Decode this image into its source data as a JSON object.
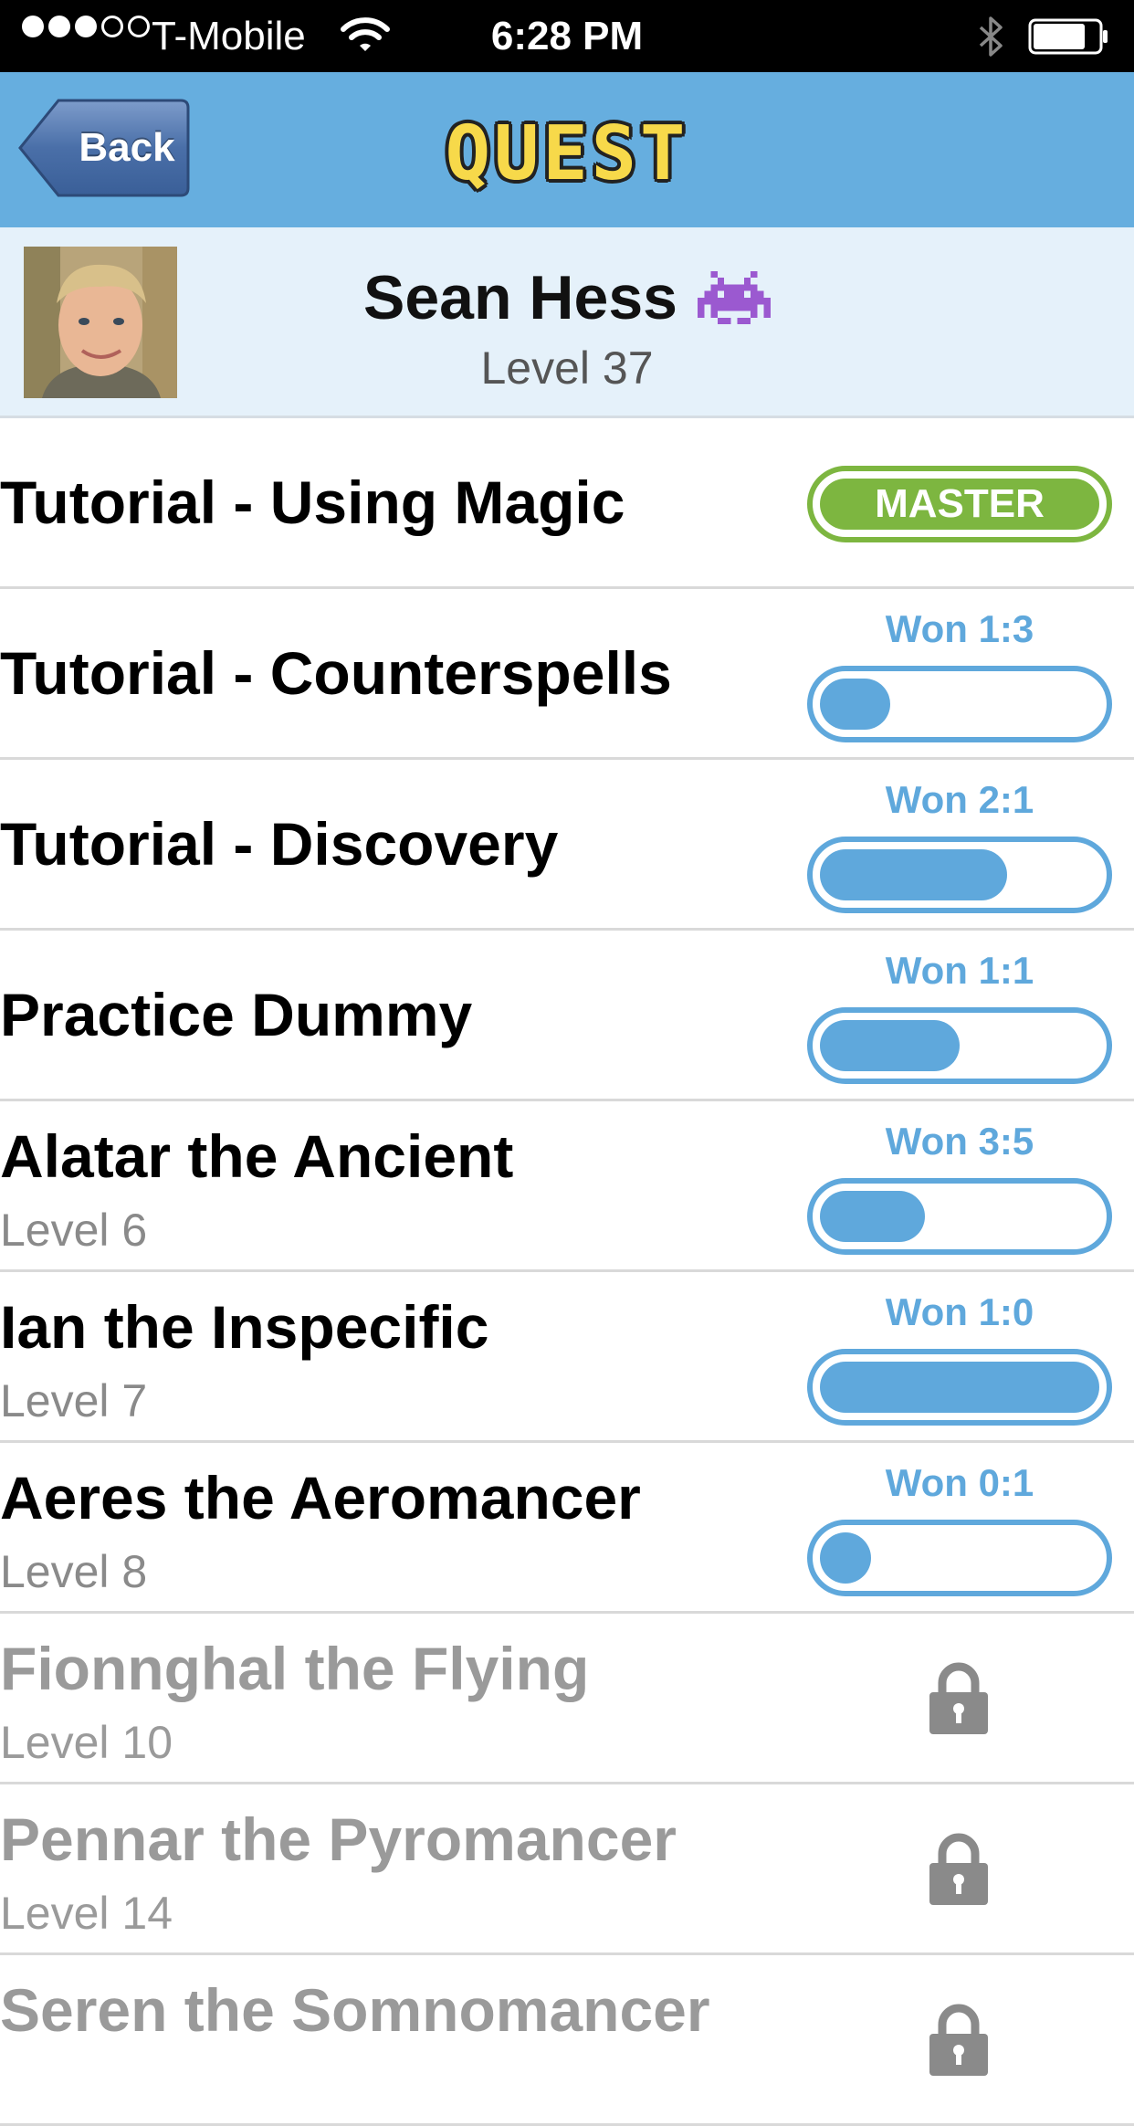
{
  "status_bar": {
    "signal_dots_filled": 3,
    "signal_dots_total": 5,
    "carrier": "T-Mobile",
    "time": "6:28 PM",
    "battery_level": 0.8
  },
  "nav": {
    "back_label": "Back",
    "title": "QUEST",
    "bar_color": "#66aedf",
    "title_color": "#f7d94a"
  },
  "profile": {
    "name": "Sean Hess",
    "level": "Level 37",
    "icon": "alien-invader-icon"
  },
  "quests": [
    {
      "title": "Tutorial - Using Magic",
      "subtitle": "",
      "status": "master",
      "badge": "MASTER"
    },
    {
      "title": "Tutorial - Counterspells",
      "subtitle": "",
      "status": "progress",
      "won": "Won 1:3",
      "progress": 0.25
    },
    {
      "title": "Tutorial - Discovery",
      "subtitle": "",
      "status": "progress",
      "won": "Won 2:1",
      "progress": 0.67
    },
    {
      "title": "Practice Dummy",
      "subtitle": "",
      "status": "progress",
      "won": "Won 1:1",
      "progress": 0.5
    },
    {
      "title": "Alatar the Ancient",
      "subtitle": "Level 6",
      "status": "progress",
      "won": "Won 3:5",
      "progress": 0.375
    },
    {
      "title": "Ian the Inspecific",
      "subtitle": "Level 7",
      "status": "progress",
      "won": "Won 1:0",
      "progress": 1.0
    },
    {
      "title": "Aeres the Aeromancer",
      "subtitle": "Level 8",
      "status": "progress",
      "won": "Won 0:1",
      "progress": 0.0
    },
    {
      "title": "Fionnghal the Flying",
      "subtitle": "Level 10",
      "status": "locked"
    },
    {
      "title": "Pennar the Pyromancer",
      "subtitle": "Level 14",
      "status": "locked"
    },
    {
      "title": "Seren the Somnomancer",
      "subtitle": "",
      "status": "locked"
    }
  ],
  "colors": {
    "progress_blue": "#5fa8dc",
    "master_green": "#7db640",
    "locked_gray": "#9a9a9a"
  }
}
